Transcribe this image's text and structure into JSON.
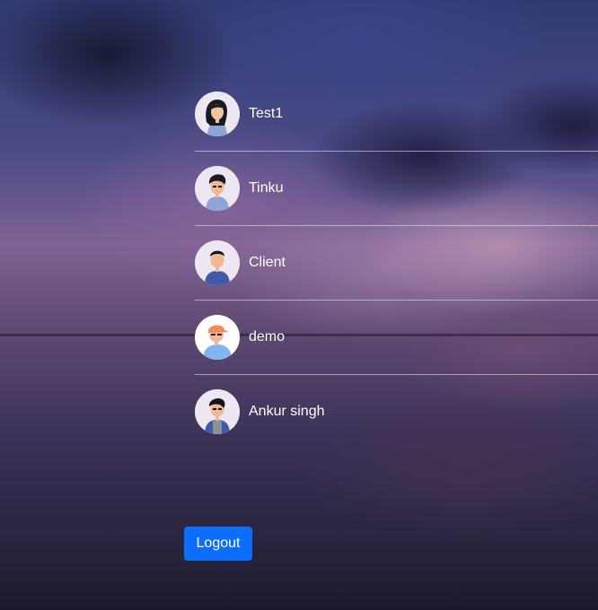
{
  "users": [
    {
      "name": "Test1",
      "avatar_icon": "woman-avatar-icon"
    },
    {
      "name": "Tinku",
      "avatar_icon": "man-avatar-icon"
    },
    {
      "name": "Client",
      "avatar_icon": "man-avatar-icon"
    },
    {
      "name": "demo",
      "avatar_icon": "man-cap-avatar-icon"
    },
    {
      "name": "Ankur singh",
      "avatar_icon": "man-avatar-icon"
    }
  ],
  "logout_label": "Logout",
  "colors": {
    "logout_button": "#0d6efd",
    "divider": "#e1e1eb",
    "text": "#ffffff"
  }
}
